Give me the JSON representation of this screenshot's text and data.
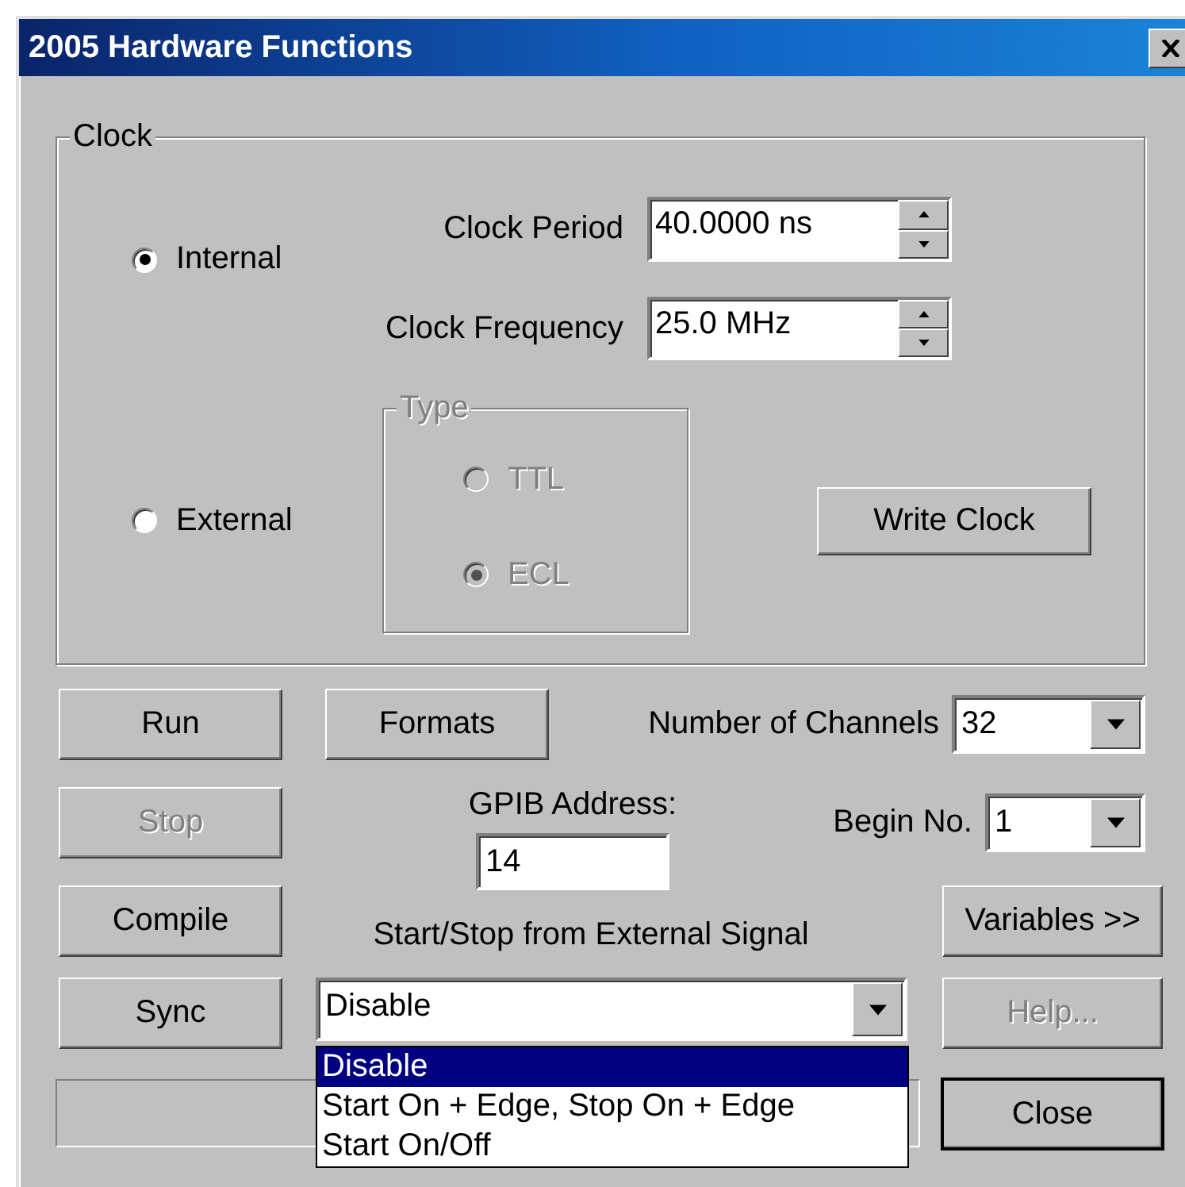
{
  "window": {
    "title": "2005 Hardware Functions"
  },
  "clock": {
    "legend": "Clock",
    "sources": [
      {
        "label": "Internal",
        "selected": true
      },
      {
        "label": "External",
        "selected": false
      }
    ],
    "fields": [
      {
        "label": "Clock Period",
        "value": "40.0000 ns"
      },
      {
        "label": "Clock Frequency",
        "value": "25.0 MHz"
      }
    ],
    "type": {
      "legend": "Type",
      "disabled": true,
      "options": [
        {
          "label": "TTL",
          "selected": false
        },
        {
          "label": "ECL",
          "selected": true
        }
      ]
    },
    "write_button": {
      "label": "Write Clock"
    }
  },
  "left_buttons": [
    {
      "label": "Run",
      "disabled": false
    },
    {
      "label": "Stop",
      "disabled": true
    },
    {
      "label": "Compile",
      "disabled": false
    },
    {
      "label": "Sync",
      "disabled": false
    }
  ],
  "formats_button": {
    "label": "Formats"
  },
  "channels": {
    "label": "Number of Channels",
    "value": "32"
  },
  "gpib": {
    "label": "GPIB Address:",
    "value": "14"
  },
  "begin": {
    "label": "Begin No.",
    "value": "1"
  },
  "external_signal": {
    "label": "Start/Stop from External Signal",
    "value": "Disable",
    "expanded": true,
    "options": [
      {
        "label": "Disable",
        "selected": true
      },
      {
        "label": "Start On + Edge, Stop On + Edge",
        "selected": false
      },
      {
        "label": "Start On/Off",
        "selected": false
      }
    ]
  },
  "right_buttons": [
    {
      "label": "Variables >>",
      "disabled": false
    },
    {
      "label": "Help...",
      "disabled": true
    }
  ],
  "close_button": {
    "label": "Close",
    "default": true
  }
}
